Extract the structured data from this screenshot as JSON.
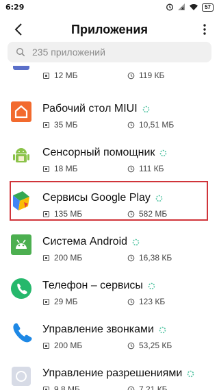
{
  "status_bar": {
    "time": "6:29",
    "battery": "57"
  },
  "header": {
    "title": "Приложения"
  },
  "search": {
    "placeholder": "235 приложений"
  },
  "apps": [
    {
      "name": "",
      "size": "12 МБ",
      "cache": "119 КБ",
      "icon": "generic-app-icon"
    },
    {
      "name": "Рабочий стол MIUI",
      "size": "35 МБ",
      "cache": "10,51 МБ",
      "icon": "home-icon",
      "color": "#f26a2e"
    },
    {
      "name": "Сенсорный помощник",
      "size": "18 МБ",
      "cache": "111 КБ",
      "icon": "android-robot-icon",
      "color": "#8bc34a"
    },
    {
      "name": "Сервисы Google Play",
      "size": "135 МБ",
      "cache": "582 МБ",
      "icon": "google-play-services-icon"
    },
    {
      "name": "Система Android",
      "size": "200 МБ",
      "cache": "16,38 КБ",
      "icon": "android-system-icon",
      "color": "#4caf50"
    },
    {
      "name": "Телефон – сервисы",
      "size": "29 МБ",
      "cache": "123 КБ",
      "icon": "phone-icon",
      "color": "#26b86c"
    },
    {
      "name": "Управление звонками",
      "size": "200 МБ",
      "cache": "53,25 КБ",
      "icon": "phone-handset-icon",
      "color": "#1e88e5"
    },
    {
      "name": "Управление разрешениями",
      "size": "9,8 МБ",
      "cache": "7,21 КБ",
      "icon": "permissions-icon"
    }
  ],
  "colors": {
    "highlight": "#d0343a",
    "spinner": "#4fc3a1"
  }
}
